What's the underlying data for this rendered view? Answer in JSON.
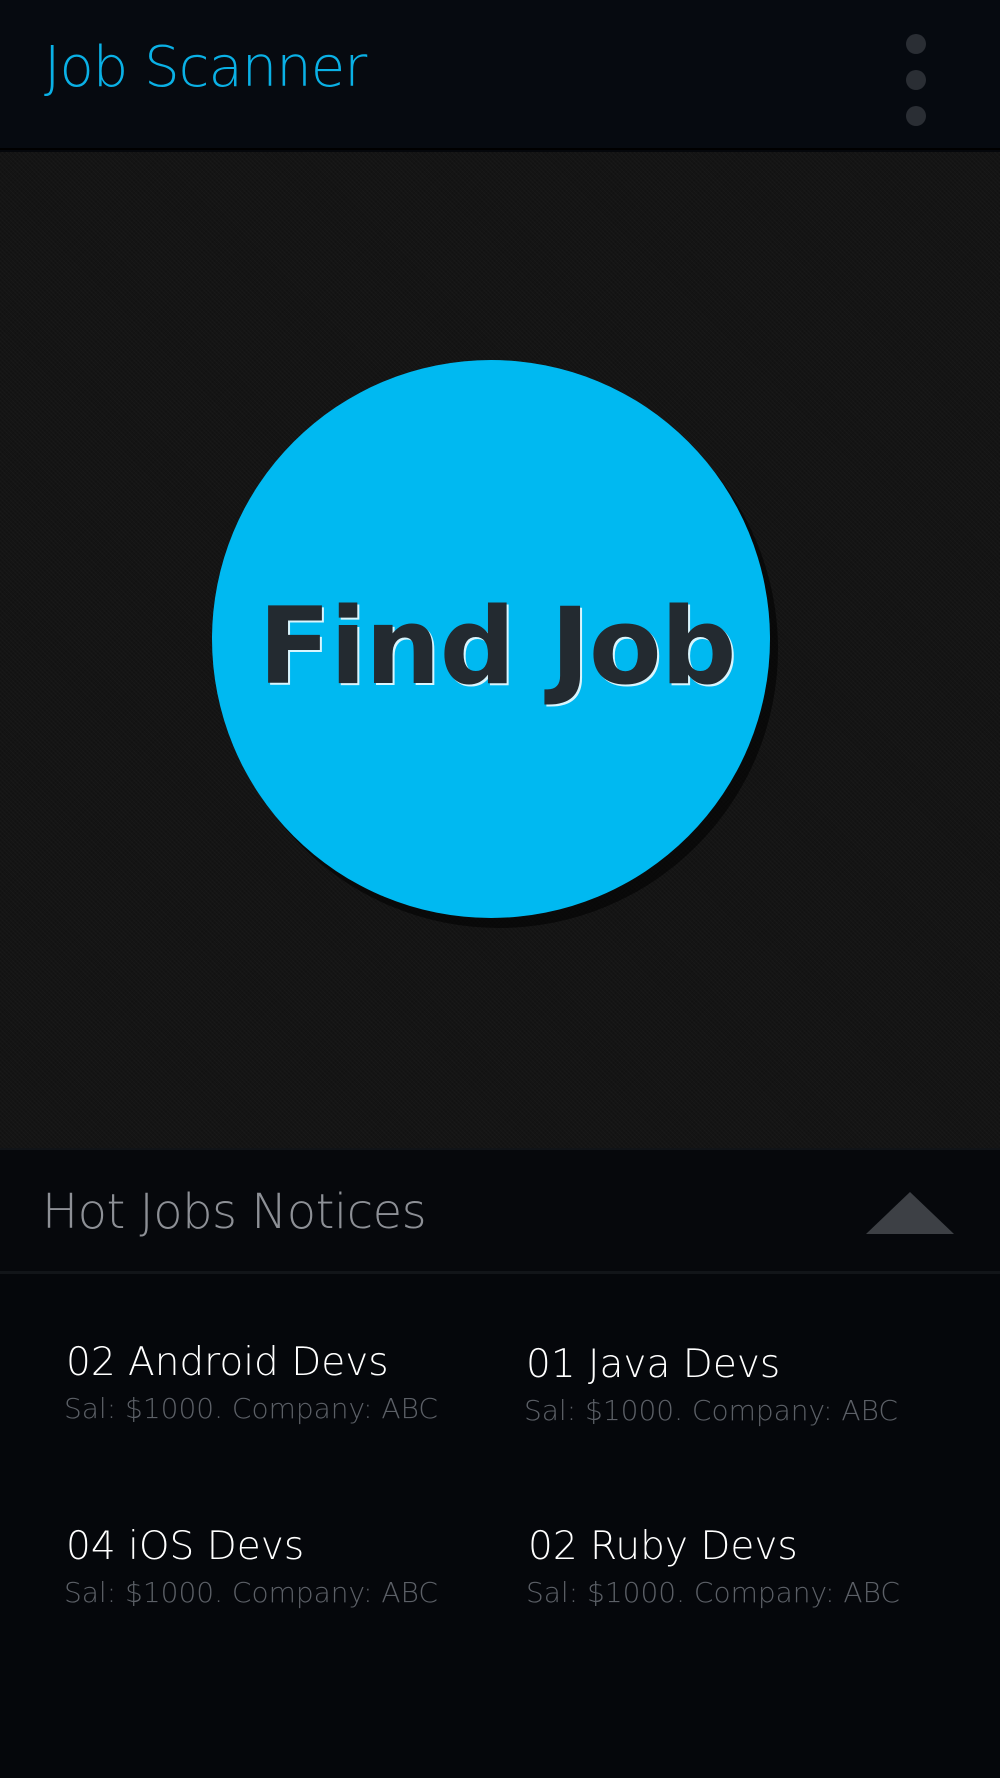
{
  "app_bar": {
    "title": "Job Scanner",
    "menu_icon": "overflow-menu-icon",
    "title_color": "#0ab1e6"
  },
  "hero": {
    "button_label": "Find Job",
    "button_color": "#00b9f1"
  },
  "notices": {
    "title": "Hot Jobs Notices",
    "toggle_icon": "triangle-up-icon",
    "jobs": [
      {
        "title": "02 Android Devs",
        "meta": "Sal: $1000. Company: ABC"
      },
      {
        "title": "01 Java Devs",
        "meta": "Sal: $1000. Company: ABC"
      },
      {
        "title": "04 iOS Devs",
        "meta": "Sal: $1000. Company: ABC"
      },
      {
        "title": "02 Ruby Devs",
        "meta": "Sal: $1000. Company: ABC"
      }
    ]
  }
}
